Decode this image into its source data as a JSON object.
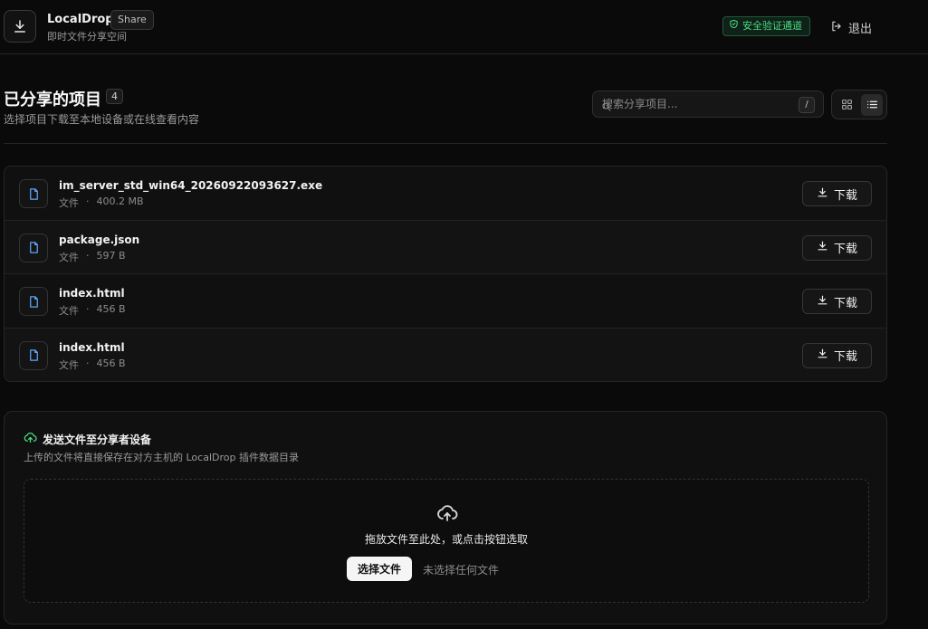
{
  "header": {
    "app_name": "LocalDrop",
    "share_badge": "Share",
    "subtitle": "即时文件分享空间",
    "secure_badge": "安全验证通道",
    "logout_label": "退出"
  },
  "section": {
    "title": "已分享的项目",
    "count": "4",
    "subtitle": "选择项目下载至本地设备或在线查看内容",
    "search_placeholder": "搜索分享项目...",
    "search_shortcut": "/"
  },
  "files": [
    {
      "name": "im_server_std_win64_20260922093627.exe",
      "type": "文件",
      "sep": "·",
      "size": "400.2 MB",
      "action": "下载"
    },
    {
      "name": "package.json",
      "type": "文件",
      "sep": "·",
      "size": "597 B",
      "action": "下载"
    },
    {
      "name": "index.html",
      "type": "文件",
      "sep": "·",
      "size": "456 B",
      "action": "下载"
    },
    {
      "name": "index.html",
      "type": "文件",
      "sep": "·",
      "size": "456 B",
      "action": "下载"
    }
  ],
  "upload": {
    "title": "发送文件至分享者设备",
    "subtitle": "上传的文件将直接保存在对方主机的 LocalDrop 插件数据目录",
    "drop_text": "拖放文件至此处，或点击按钮选取",
    "choose_label": "选择文件",
    "no_file_label": "未选择任何文件"
  },
  "colors": {
    "background": "#0a0a0a",
    "accent_green": "#4ade80",
    "file_icon_blue": "#60a5fa"
  }
}
